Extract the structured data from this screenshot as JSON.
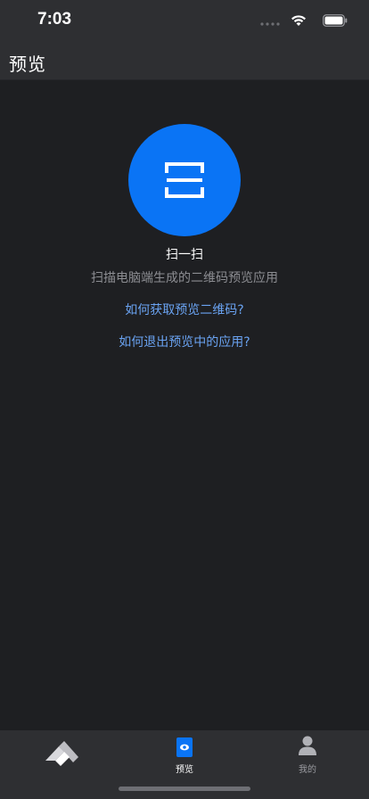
{
  "status_bar": {
    "time": "7:03"
  },
  "header": {
    "title": "预览"
  },
  "scan": {
    "title": "扫一扫",
    "description": "扫描电脑端生成的二维码预览应用",
    "accent_color": "#0a74f5",
    "icon": "scan-frame-icon"
  },
  "help_links": [
    {
      "label": "如何获取预览二维码?"
    },
    {
      "label": "如何退出预览中的应用?"
    }
  ],
  "tab_bar": {
    "items": [
      {
        "label": "",
        "icon": "app-logo-icon"
      },
      {
        "label": "预览",
        "icon": "eye-icon",
        "active": true
      },
      {
        "label": "我的",
        "icon": "user-icon"
      }
    ],
    "active_color": "#0a74f5"
  }
}
